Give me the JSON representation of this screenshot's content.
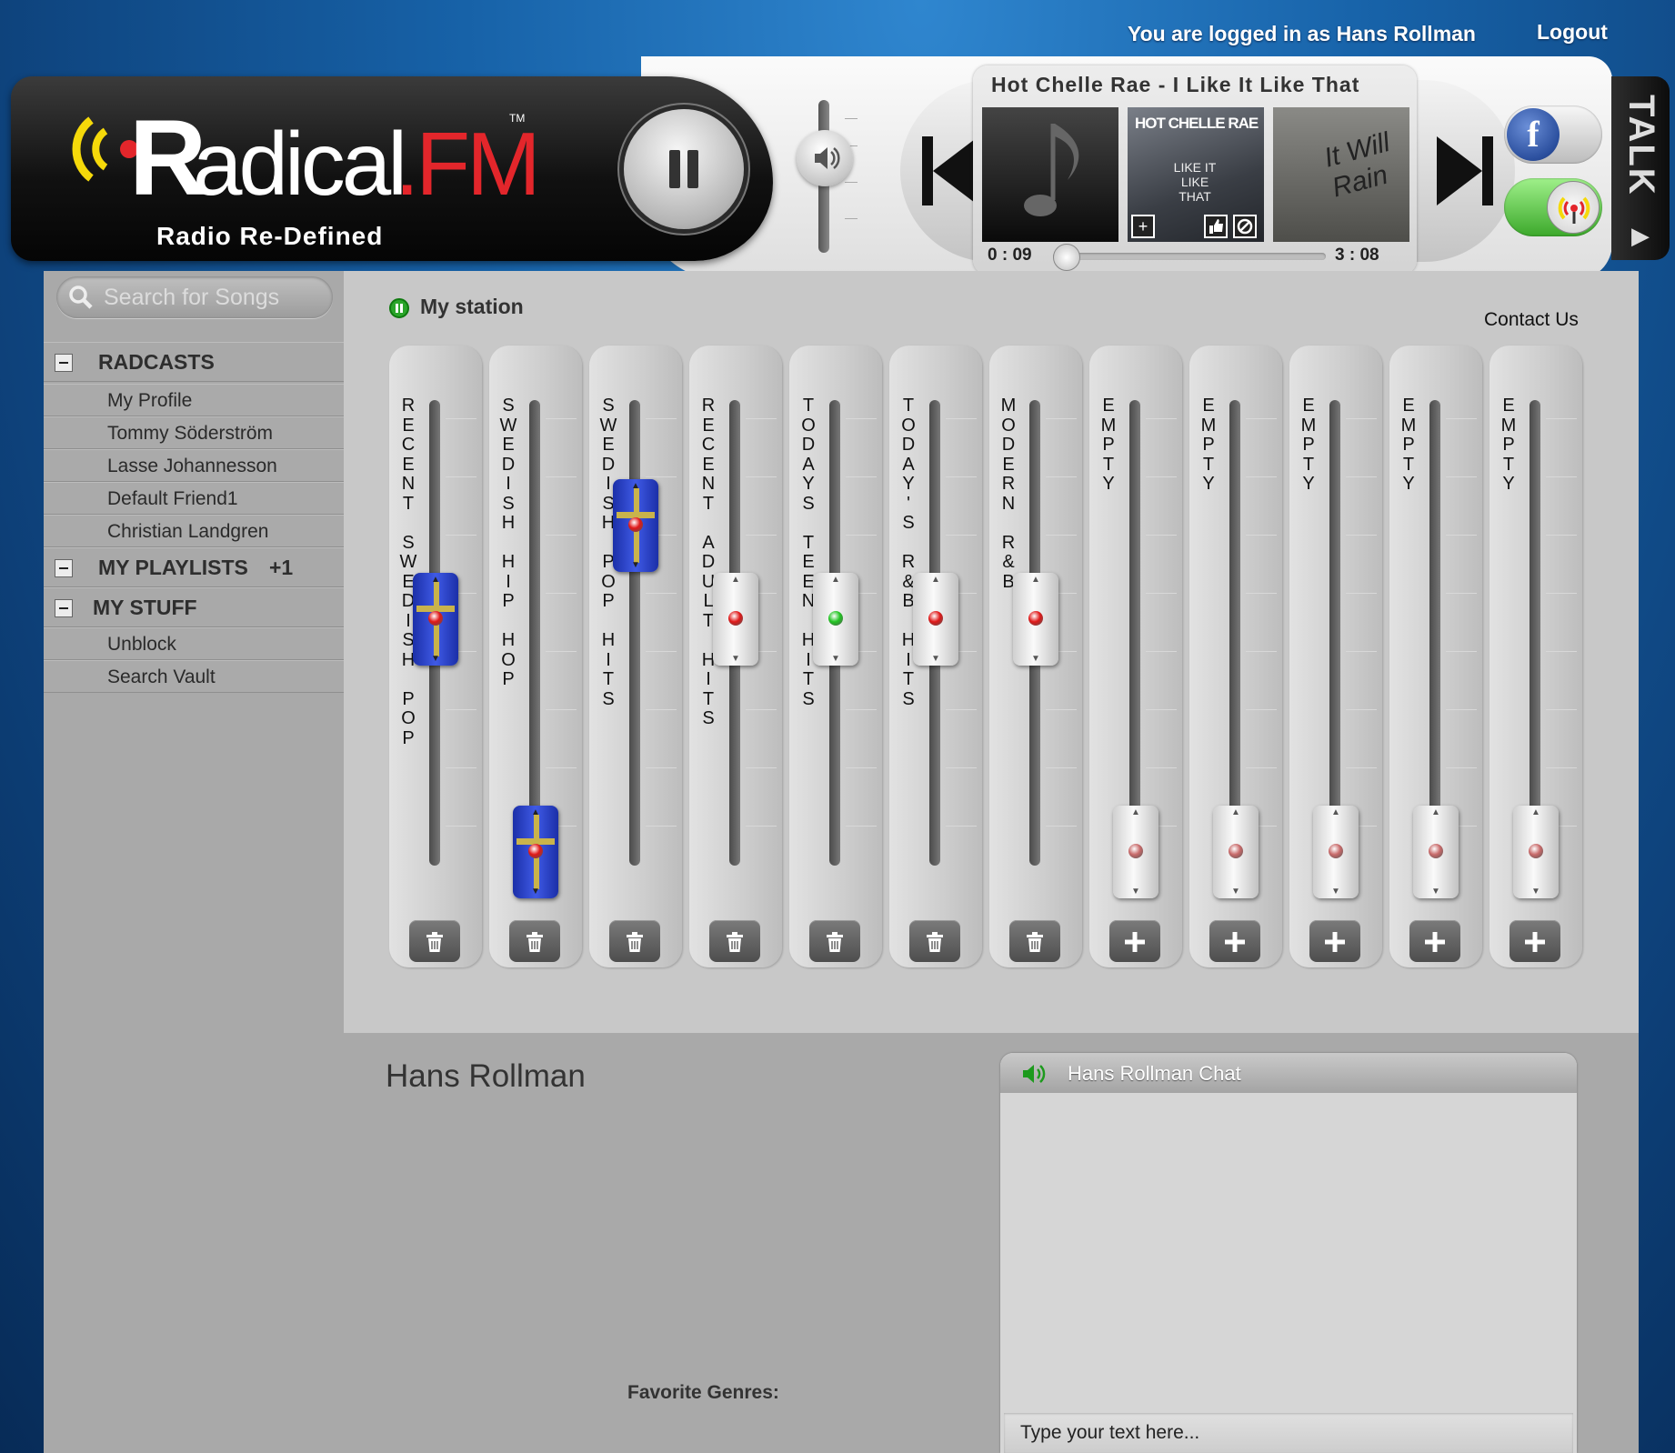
{
  "header": {
    "logged_in_text": "You are logged in as Hans Rollman",
    "logout_label": "Logout",
    "logo_text_main": "adical",
    "logo_text_fm": ".FM",
    "logo_tm": "TM",
    "tagline": "Radio Re-Defined"
  },
  "player": {
    "now_playing": "Hot Chelle Rae - I Like It Like That",
    "time_current": "0 : 09",
    "time_total": "3 : 08",
    "progress_fraction": 0.05,
    "volume_fraction": 0.62,
    "state": "playing",
    "album_art": [
      {
        "name": "placeholder-music-note"
      },
      {
        "name": "Hot Chelle Rae - Like It Like That",
        "caption": "HOT CHELLE RAE",
        "subcaption": "LIKE IT LIKE THAT"
      },
      {
        "name": "It Will Rain",
        "caption": "It Will Rain"
      }
    ]
  },
  "social": {
    "facebook_letter": "f",
    "talk_label": "TALK"
  },
  "search": {
    "placeholder": "Search for Songs"
  },
  "sidebar": {
    "radcasts": {
      "label": "RADCASTS",
      "items": [
        "My Profile",
        "Tommy Söderström",
        "Lasse Johannesson",
        "Default Friend1",
        "Christian Landgren"
      ]
    },
    "playlists": {
      "label": "MY PLAYLISTS",
      "badge": "+1"
    },
    "mystuff": {
      "label": "MY STUFF",
      "items": [
        "Unblock",
        "Search Vault"
      ]
    }
  },
  "station": {
    "label": "My station",
    "contact": "Contact Us"
  },
  "channels": [
    {
      "label": "RECENT SWEDISH POP",
      "level": 0.53,
      "style": "blue",
      "led": "red",
      "action": "delete"
    },
    {
      "label": "SWEDISH HIP HOP",
      "level": 0.03,
      "style": "blue",
      "led": "red",
      "action": "delete"
    },
    {
      "label": "SWEDISH POP HITS",
      "level": 0.73,
      "style": "blue",
      "led": "red",
      "action": "delete"
    },
    {
      "label": "RECENT ADULT HITS",
      "level": 0.53,
      "style": "grey",
      "led": "red",
      "action": "delete"
    },
    {
      "label": "TODAYS TEEN HITS",
      "level": 0.53,
      "style": "grey",
      "led": "green",
      "action": "delete"
    },
    {
      "label": "TODAY'S R&B HITS",
      "level": 0.53,
      "style": "grey",
      "led": "red",
      "action": "delete"
    },
    {
      "label": "MODERN R&B",
      "level": 0.53,
      "style": "grey",
      "led": "red",
      "action": "delete"
    },
    {
      "label": "EMPTY",
      "level": 0.03,
      "style": "grey",
      "led": "dim",
      "action": "add"
    },
    {
      "label": "EMPTY",
      "level": 0.03,
      "style": "grey",
      "led": "dim",
      "action": "add"
    },
    {
      "label": "EMPTY",
      "level": 0.03,
      "style": "grey",
      "led": "dim",
      "action": "add"
    },
    {
      "label": "EMPTY",
      "level": 0.03,
      "style": "grey",
      "led": "dim",
      "action": "add"
    },
    {
      "label": "EMPTY",
      "level": 0.03,
      "style": "grey",
      "led": "dim",
      "action": "add"
    }
  ],
  "profile": {
    "name": "Hans Rollman",
    "favorite_genres_label": "Favorite Genres:"
  },
  "chat": {
    "title": "Hans Rollman Chat",
    "input_placeholder": "Type your text here..."
  },
  "colors": {
    "led_red": "#e01818",
    "led_green": "#22c422",
    "led_dim": "#c86a6a",
    "fm_red": "#e3262b",
    "logo_yellow": "#f5d90a"
  }
}
